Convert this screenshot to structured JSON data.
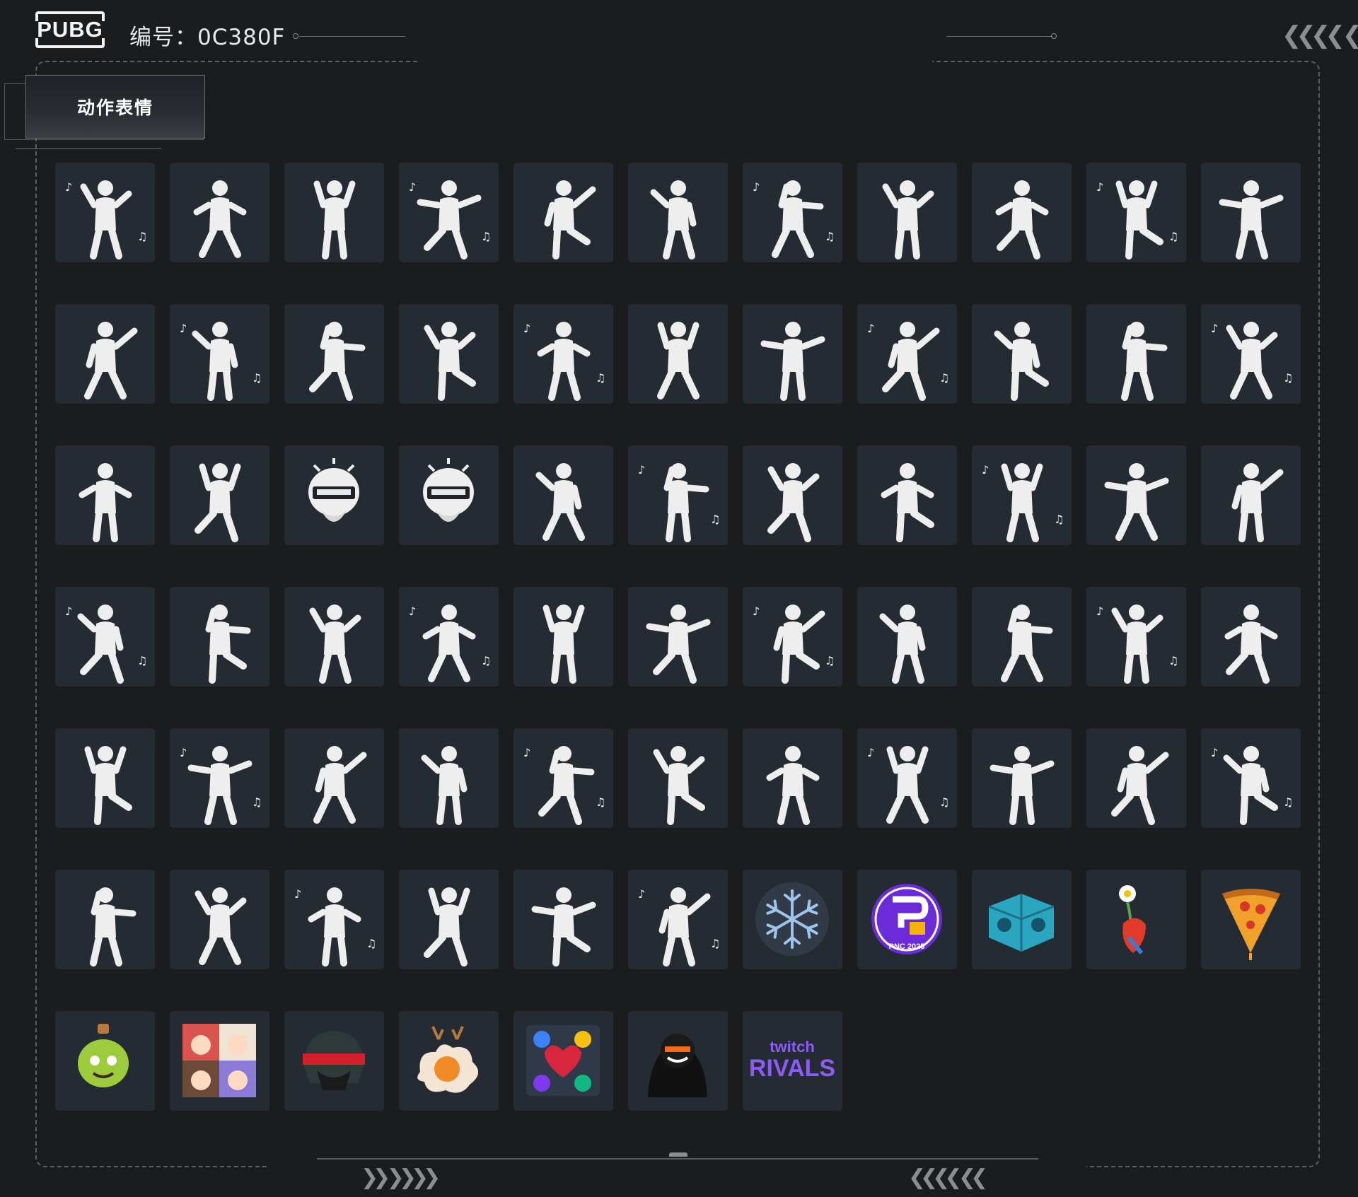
{
  "header": {
    "logo_text": "PUBG",
    "serial_label": "编号：0C380F"
  },
  "category": {
    "tab_label": "动作表情"
  },
  "emotes": [
    {
      "icon": "dancer-raised-fist-icon",
      "kind": "figure"
    },
    {
      "icon": "money-throw-icon",
      "kind": "figure"
    },
    {
      "icon": "bell-music-icon",
      "kind": "figure"
    },
    {
      "icon": "crouch-lunge-icon",
      "kind": "figure"
    },
    {
      "icon": "zombie-walk-icon",
      "kind": "figure"
    },
    {
      "icon": "point-up-icon",
      "kind": "figure"
    },
    {
      "icon": "dab-icon",
      "kind": "figure"
    },
    {
      "icon": "hoodie-girl-dance-icon",
      "kind": "figure"
    },
    {
      "icon": "girl-wave-music-icon",
      "kind": "figure"
    },
    {
      "icon": "hearts-hug-icon",
      "kind": "figure"
    },
    {
      "icon": "girl-music-pose-icon",
      "kind": "figure"
    },
    {
      "icon": "girl-sing-icon",
      "kind": "figure"
    },
    {
      "icon": "tea-sip-icon",
      "kind": "figure"
    },
    {
      "icon": "kneel-beg-icon",
      "kind": "figure"
    },
    {
      "icon": "high-kick-icon",
      "kind": "figure"
    },
    {
      "icon": "shadow-box-icon",
      "kind": "figure"
    },
    {
      "icon": "head-scratch-icon",
      "kind": "figure"
    },
    {
      "icon": "idol-pose-icon",
      "kind": "figure"
    },
    {
      "icon": "mirror-dance-icon",
      "kind": "figure"
    },
    {
      "icon": "heart-hand-icon",
      "kind": "figure"
    },
    {
      "icon": "hands-up-icon",
      "kind": "figure"
    },
    {
      "icon": "wave-hand-icon",
      "kind": "figure"
    },
    {
      "icon": "head-shake-icon",
      "kind": "figure"
    },
    {
      "icon": "chin-rest-icon",
      "kind": "figure"
    },
    {
      "icon": "angry-helmet-icon",
      "kind": "helmet"
    },
    {
      "icon": "laugh-helmet-icon",
      "kind": "helmet"
    },
    {
      "icon": "clap-icon",
      "kind": "figure"
    },
    {
      "icon": "facepalm-think-icon",
      "kind": "figure"
    },
    {
      "icon": "dizzy-icon",
      "kind": "figure"
    },
    {
      "icon": "point-finger-icon",
      "kind": "figure"
    },
    {
      "icon": "come-here-icon",
      "kind": "figure"
    },
    {
      "icon": "shrug-icon",
      "kind": "figure"
    },
    {
      "icon": "nod-arms-crossed-icon",
      "kind": "figure"
    },
    {
      "icon": "slap-icon",
      "kind": "figure"
    },
    {
      "icon": "cover-face-icon",
      "kind": "figure"
    },
    {
      "icon": "facepalm-icon",
      "kind": "figure"
    },
    {
      "icon": "stop-hand-icon",
      "kind": "figure"
    },
    {
      "icon": "arms-crossed-icon",
      "kind": "figure"
    },
    {
      "icon": "thumbs-up-icon",
      "kind": "figure"
    },
    {
      "icon": "disco-point-icon",
      "kind": "figure"
    },
    {
      "icon": "duo-dance-1-icon",
      "kind": "figure"
    },
    {
      "icon": "duo-dance-2-icon",
      "kind": "figure"
    },
    {
      "icon": "duo-dance-3-icon",
      "kind": "figure"
    },
    {
      "icon": "duo-dance-4-icon",
      "kind": "figure"
    },
    {
      "icon": "kick-dance-icon",
      "kind": "figure"
    },
    {
      "icon": "duo-dance-5-icon",
      "kind": "figure"
    },
    {
      "icon": "duo-dance-6-icon",
      "kind": "figure"
    },
    {
      "icon": "solo-groove-icon",
      "kind": "figure"
    },
    {
      "icon": "duo-dance-7-icon",
      "kind": "figure"
    },
    {
      "icon": "duo-slide-icon",
      "kind": "figure"
    },
    {
      "icon": "point-dance-icon",
      "kind": "figure"
    },
    {
      "icon": "headspin-icon",
      "kind": "figure"
    },
    {
      "icon": "idol-group-1-icon",
      "kind": "figure"
    },
    {
      "icon": "idol-group-2-icon",
      "kind": "figure"
    },
    {
      "icon": "idol-group-3-icon",
      "kind": "figure"
    },
    {
      "icon": "idol-group-4-icon",
      "kind": "figure"
    },
    {
      "icon": "duo-kick-icon",
      "kind": "figure"
    },
    {
      "icon": "duo-hands-up-icon",
      "kind": "figure"
    },
    {
      "icon": "duo-slide-2-icon",
      "kind": "figure"
    },
    {
      "icon": "duo-clap-up-icon",
      "kind": "figure"
    },
    {
      "icon": "breakdance-icon",
      "kind": "figure"
    },
    {
      "icon": "snowflake-icon",
      "kind": "snowflake"
    },
    {
      "icon": "pnc-2025-icon",
      "kind": "pnc",
      "text": "PNC 2025"
    },
    {
      "icon": "speaker-cube-icon",
      "kind": "speakers"
    },
    {
      "icon": "flower-heart-icon",
      "kind": "flower"
    },
    {
      "icon": "pizza-slice-icon",
      "kind": "pizza"
    },
    {
      "icon": "potion-frog-icon",
      "kind": "potion"
    },
    {
      "icon": "anime-girls-card-icon",
      "kind": "anime"
    },
    {
      "icon": "visor-helmet-icon",
      "kind": "visor"
    },
    {
      "icon": "egg-reindeer-icon",
      "kind": "egg"
    },
    {
      "icon": "graffiti-heart-icon",
      "kind": "graffiti"
    },
    {
      "icon": "hooded-grin-icon",
      "kind": "hood"
    },
    {
      "icon": "twitch-rivals-icon",
      "kind": "twitch",
      "text": [
        "twitch",
        "RIVALS"
      ]
    }
  ],
  "colors": {
    "background": "#1b1c1e",
    "tile": "#252b33",
    "frame": "#5c5e62",
    "twitch_purple": "#8b5cf6",
    "pnc_purple": "#6b2bd9"
  }
}
